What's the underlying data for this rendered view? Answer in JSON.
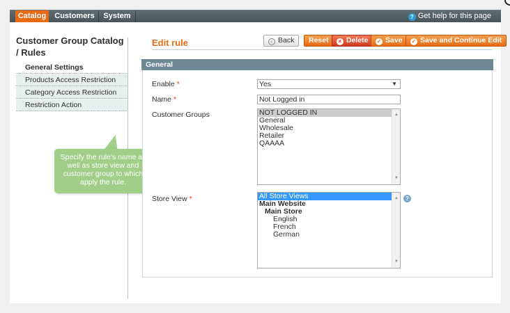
{
  "nav": {
    "items": [
      "Catalog",
      "Customers",
      "System"
    ],
    "help": "Get help for this page"
  },
  "sidebar": {
    "title": "Customer Group Catalog / Rules",
    "tabs": [
      "General Settings",
      "Products Access Restriction",
      "Category Access Restriction",
      "Restriction Action"
    ]
  },
  "tooltip": "Specify the rule's name as well as store view and customer group to which apply the rule.",
  "page": {
    "title": "Edit rule",
    "buttons": {
      "back": "Back",
      "reset": "Reset",
      "delete": "Delete",
      "save": "Save",
      "save_continue": "Save and Continue Edit"
    }
  },
  "general": {
    "header": "General",
    "enable_label": "Enable",
    "enable_value": "Yes",
    "name_label": "Name",
    "name_value": "Not Logged in",
    "groups_label": "Customer Groups",
    "groups": [
      "NOT LOGGED IN",
      "General",
      "Wholesale",
      "Retailer",
      "QAAAA"
    ],
    "store_label": "Store View",
    "stores": [
      "All Store Views",
      "Main Website",
      "Main Store",
      "English",
      "French",
      "German"
    ],
    "required_mark": "*"
  },
  "colors": {
    "accent": "#e86b14",
    "header_bar": "#6f8992",
    "tooltip": "#a0cf89"
  }
}
